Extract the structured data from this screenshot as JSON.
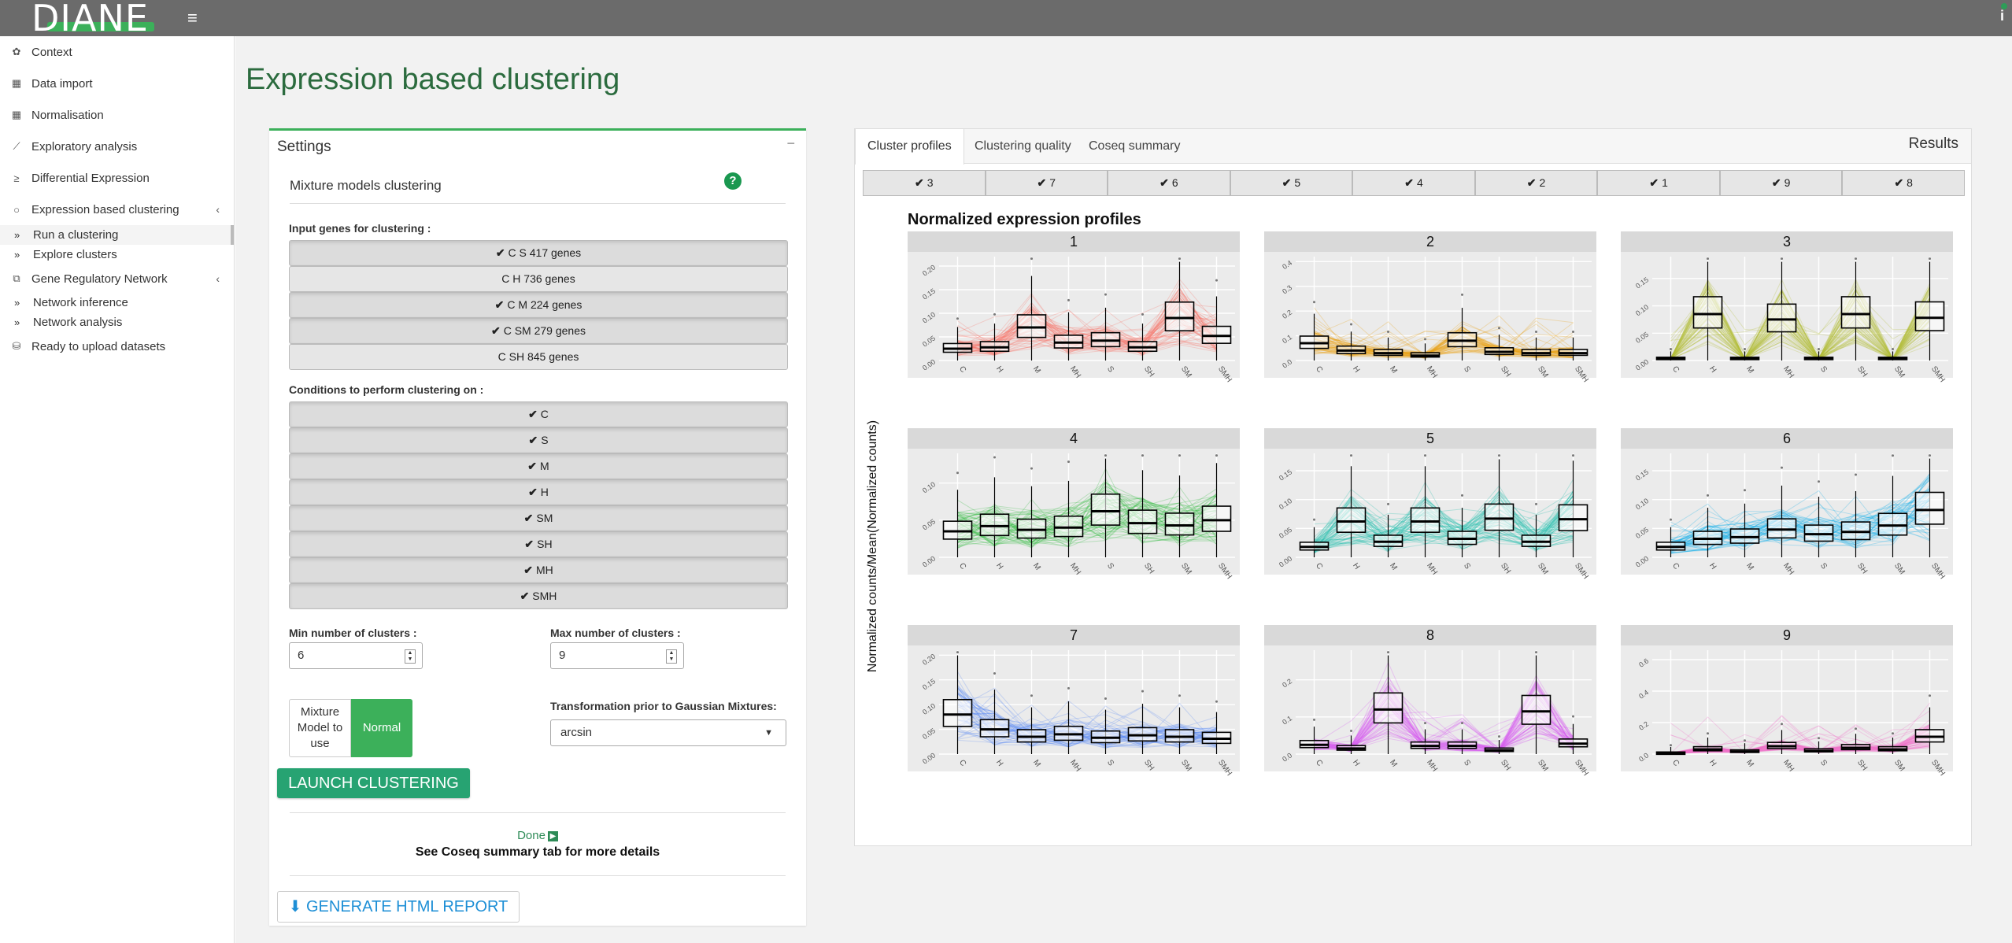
{
  "app": {
    "logo": "DIANE",
    "menu_icon": "hamburger-icon",
    "notify_icon": "info-icon"
  },
  "sidebar": {
    "items": [
      {
        "label": "Context",
        "icon": "seedling-icon",
        "top": 0
      },
      {
        "label": "Data import",
        "icon": "table-icon"
      },
      {
        "label": "Normalisation",
        "icon": "table-icon"
      },
      {
        "label": "Exploratory analysis",
        "icon": "chart-icon"
      },
      {
        "label": "Differential Expression",
        "icon": "gte-icon"
      },
      {
        "label": "Expression based clustering",
        "icon": "circle-icon",
        "chevron": true
      }
    ],
    "clustering_sub": [
      {
        "label": "Run a clustering",
        "active": true
      },
      {
        "label": "Explore clusters",
        "active": false
      }
    ],
    "grn": {
      "label": "Gene Regulatory Network",
      "icon": "network-icon",
      "chevron": true
    },
    "grn_sub": [
      {
        "label": "Network inference"
      },
      {
        "label": "Network analysis"
      }
    ],
    "upload": {
      "label": "Ready to upload datasets",
      "icon": "database-icon"
    }
  },
  "page": {
    "title": "Expression based clustering"
  },
  "settings": {
    "title": "Settings",
    "collapse": "−",
    "mixture_title": "Mixture models clustering",
    "input_label": "Input genes for clustering :",
    "input_genes": [
      {
        "label": "C S 417 genes",
        "checked": true
      },
      {
        "label": "C H 736 genes",
        "checked": false
      },
      {
        "label": "C M 224 genes",
        "checked": true
      },
      {
        "label": "C SM 279 genes",
        "checked": true
      },
      {
        "label": "C SH 845 genes",
        "checked": false
      }
    ],
    "conditions_label": "Conditions to perform clustering on :",
    "conditions": [
      "C",
      "S",
      "M",
      "H",
      "SM",
      "SH",
      "MH",
      "SMH"
    ],
    "min_label": "Min number of clusters :",
    "min_value": "6",
    "max_label": "Max number of clusters :",
    "max_value": "9",
    "mixture_model_label": "Mixture Model to use",
    "mixture_model_value": "Normal",
    "transform_label": "Transformation prior to Gaussian Mixtures:",
    "transform_value": "arcsin",
    "launch_label": "LAUNCH CLUSTERING",
    "done_label": "Done",
    "coseq_note": "See Coseq summary tab for more details",
    "report_label": "GENERATE HTML REPORT"
  },
  "results": {
    "title": "Results",
    "tabs": [
      "Cluster profiles",
      "Clustering quality",
      "Coseq summary"
    ],
    "active_tab": 0,
    "cluster_buttons": [
      "3",
      "7",
      "6",
      "5",
      "4",
      "2",
      "1",
      "9",
      "8"
    ]
  },
  "chart_data": {
    "type": "boxplot",
    "title": "Normalized expression profiles",
    "ylabel": "Normalized counts/Mean(Normalized counts)",
    "categories": [
      "C",
      "H",
      "M",
      "MH",
      "S",
      "SH",
      "SM",
      "SMH"
    ],
    "panels": [
      {
        "name": "1",
        "color": "#f8766d",
        "yticks": [
          "0.00",
          "0.05",
          "0.10",
          "0.15",
          "0.20"
        ],
        "ymax": 0.22,
        "medians": [
          0.025,
          0.028,
          0.07,
          0.038,
          0.042,
          0.028,
          0.09,
          0.052
        ]
      },
      {
        "name": "2",
        "color": "#e8a317",
        "yticks": [
          "0.0",
          "0.1",
          "0.2",
          "0.3",
          "0.4"
        ],
        "ymax": 0.42,
        "medians": [
          0.07,
          0.04,
          0.03,
          0.02,
          0.08,
          0.035,
          0.03,
          0.03
        ]
      },
      {
        "name": "3",
        "color": "#b5bf3a",
        "yticks": [
          "0.00",
          "0.05",
          "0.10",
          "0.15"
        ],
        "ymax": 0.19,
        "medians": [
          0.003,
          0.085,
          0.003,
          0.075,
          0.003,
          0.085,
          0.003,
          0.078
        ]
      },
      {
        "name": "4",
        "color": "#2dbb3c",
        "yticks": [
          "0.00",
          "0.05",
          "0.10"
        ],
        "ymax": 0.14,
        "medians": [
          0.035,
          0.042,
          0.037,
          0.04,
          0.062,
          0.046,
          0.043,
          0.05
        ]
      },
      {
        "name": "5",
        "color": "#1fc0ab",
        "yticks": [
          "0.00",
          "0.05",
          "0.10",
          "0.15"
        ],
        "ymax": 0.18,
        "medians": [
          0.018,
          0.062,
          0.027,
          0.062,
          0.032,
          0.067,
          0.027,
          0.066
        ]
      },
      {
        "name": "6",
        "color": "#16b1e8",
        "yticks": [
          "0.00",
          "0.05",
          "0.10",
          "0.15"
        ],
        "ymax": 0.18,
        "medians": [
          0.018,
          0.032,
          0.035,
          0.048,
          0.04,
          0.044,
          0.055,
          0.082
        ]
      },
      {
        "name": "7",
        "color": "#5f8df5",
        "yticks": [
          "0.00",
          "0.05",
          "0.10",
          "0.15",
          "0.20"
        ],
        "ymax": 0.21,
        "medians": [
          0.08,
          0.05,
          0.035,
          0.04,
          0.033,
          0.038,
          0.035,
          0.031
        ]
      },
      {
        "name": "8",
        "color": "#d85cf0",
        "yticks": [
          "0.0",
          "0.1",
          "0.2"
        ],
        "ymax": 0.28,
        "medians": [
          0.025,
          0.015,
          0.12,
          0.022,
          0.022,
          0.01,
          0.115,
          0.028
        ]
      },
      {
        "name": "9",
        "color": "#f06ec8",
        "yticks": [
          "0.0",
          "0.2",
          "0.4",
          "0.6"
        ],
        "ymax": 0.66,
        "medians": [
          0.005,
          0.03,
          0.015,
          0.05,
          0.02,
          0.04,
          0.03,
          0.11
        ]
      }
    ]
  }
}
